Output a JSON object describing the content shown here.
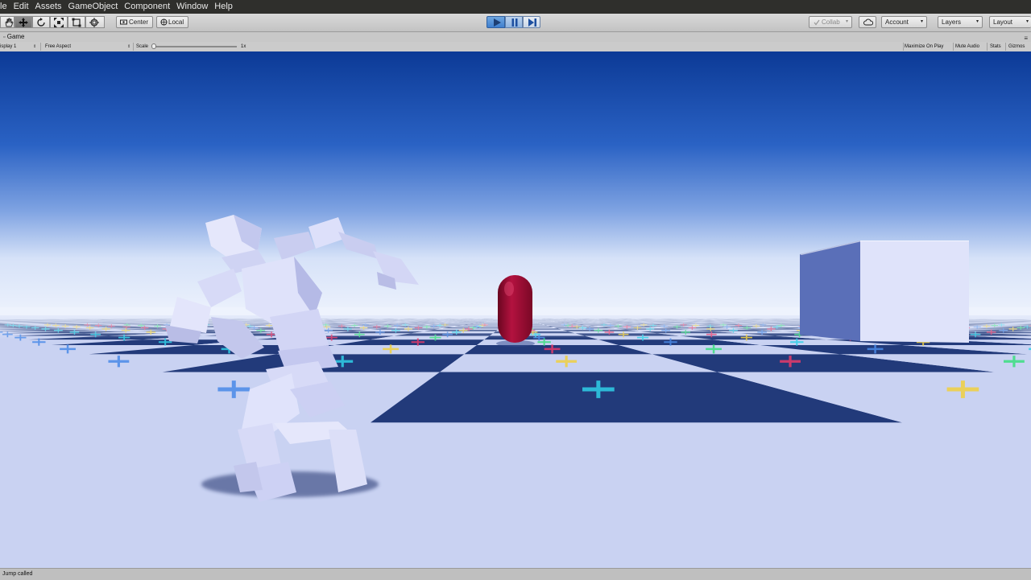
{
  "menu": [
    "le",
    "Edit",
    "Assets",
    "GameObject",
    "Component",
    "Window",
    "Help"
  ],
  "toolbar": {
    "tools": [
      "hand-tool",
      "move-tool",
      "rotate-tool",
      "scale-tool",
      "rect-tool",
      "transform-tool"
    ],
    "pivot_label": "Center",
    "space_label": "Local",
    "collab_label": "Collab",
    "account_label": "Account",
    "layers_label": "Layers",
    "layout_label": "Layout"
  },
  "game_tab": {
    "label": "Game"
  },
  "game_toolbar": {
    "display": "isplay 1",
    "aspect": "Free Aspect",
    "scale_label": "Scale",
    "scale_value": "1x",
    "maximize_on_play": "Maximize On Play",
    "mute_audio": "Mute Audio",
    "stats": "Stats",
    "gizmos": "Gizmos"
  },
  "status": {
    "message": "Jump called"
  },
  "colors": {
    "play_active": "#3f7fcf",
    "capsule": "#a4103a",
    "sky_top": "#0c3a96",
    "floor_dark": "#223a7a",
    "floor_light": "#c9d2f2"
  }
}
